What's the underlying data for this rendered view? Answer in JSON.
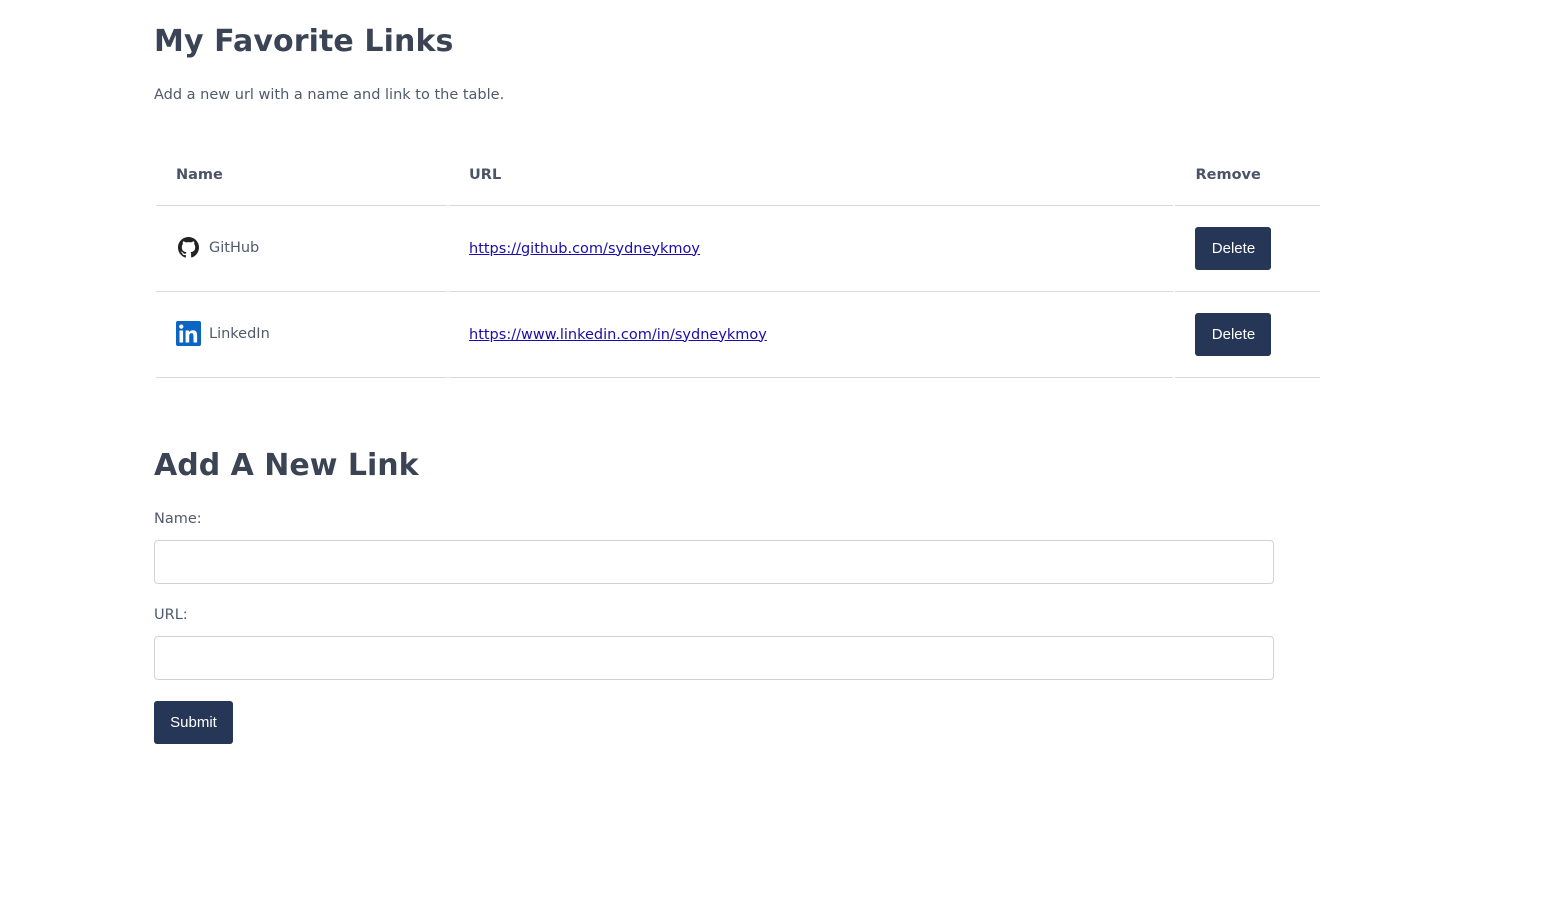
{
  "page": {
    "title": "My Favorite Links",
    "subtitle": "Add a new url with a name and link to the table."
  },
  "table": {
    "headers": {
      "name": "Name",
      "url": "URL",
      "remove": "Remove"
    },
    "rows": [
      {
        "name": "GitHub",
        "icon": "github-icon",
        "url": "https://github.com/sydneykmoy",
        "delete_label": "Delete"
      },
      {
        "name": "LinkedIn",
        "icon": "linkedin-icon",
        "url": "https://www.linkedin.com/in/sydneykmoy",
        "delete_label": "Delete"
      }
    ]
  },
  "form": {
    "title": "Add A New Link",
    "name_label": "Name:",
    "name_value": "",
    "url_label": "URL:",
    "url_value": "",
    "submit_label": "Submit"
  },
  "colors": {
    "button": "#253656",
    "link": "#1a0dab",
    "heading": "#3a4455",
    "linkedin": "#0a66c2"
  }
}
